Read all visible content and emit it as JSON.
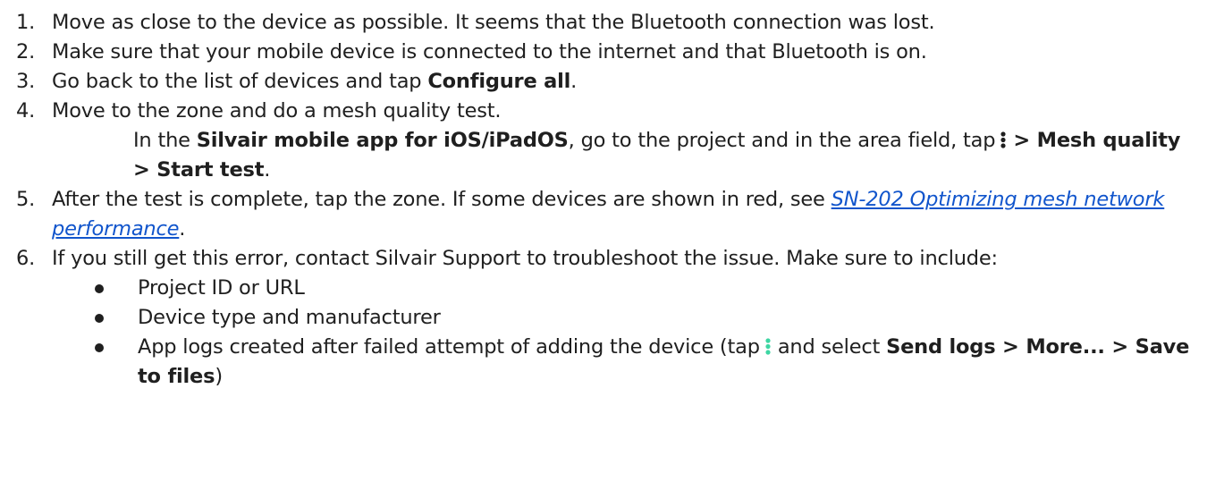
{
  "steps": [
    {
      "num": "1.",
      "text": "Move as close to the device as possible. It seems that the Bluetooth connection was lost."
    },
    {
      "num": "2.",
      "text": "Make sure that your mobile device is connected to the internet and that Bluetooth is on."
    },
    {
      "num": "3.",
      "pre": "Go back to the list of devices and tap ",
      "bold": "Configure all",
      "post": "."
    },
    {
      "num": "4.",
      "text": "Move to the zone and do a mesh quality test."
    },
    {
      "num": "5.",
      "pre": "After the test is complete, tap the zone. If some devices are shown in red, see ",
      "link": "SN-202 Optimizing mesh network performance",
      "post": "."
    },
    {
      "num": "6.",
      "text": "If you still get this error, contact Silvair Support to troubleshoot the issue. Make sure to include:"
    }
  ],
  "step4_detail": {
    "pre": "In the ",
    "bold_app": "Silvair mobile app for iOS/iPadOS",
    "mid": ", go to the project and in the area field, tap",
    "bold_path": "> Mesh quality > Start test",
    "post": ".",
    "icon": "kebab-menu-icon",
    "icon_color": "#1f1f1f"
  },
  "include_items": [
    {
      "text": "Project ID or URL"
    },
    {
      "text": "Device type and manufacturer"
    },
    {
      "pre": "App logs created after failed attempt of adding the device (tap",
      "icon": "kebab-menu-icon",
      "icon_color": "#3ed6a3",
      "mid": "and select ",
      "bold": "Send logs > More... > Save to files",
      "post": ")"
    }
  ]
}
